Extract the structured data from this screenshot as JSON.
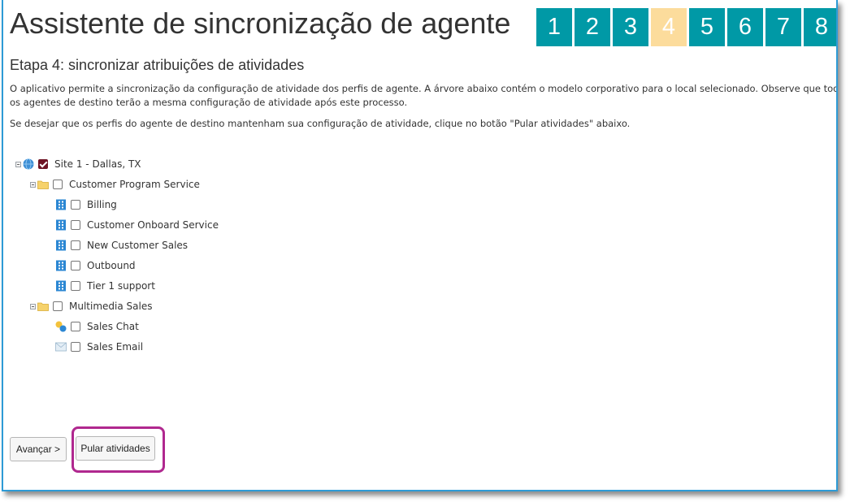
{
  "title": "Assistente de sincronização de agente",
  "steps": [
    {
      "label": "1",
      "active": false
    },
    {
      "label": "2",
      "active": false
    },
    {
      "label": "3",
      "active": false
    },
    {
      "label": "4",
      "active": true
    },
    {
      "label": "5",
      "active": false
    },
    {
      "label": "6",
      "active": false
    },
    {
      "label": "7",
      "active": false
    },
    {
      "label": "8",
      "active": false
    }
  ],
  "subtitle": "Etapa 4: sincronizar atribuições de atividades",
  "description": "O aplicativo permite a sincronização da configuração de atividade dos perfis de agente. A árvore abaixo contém o modelo corporativo para o local selecionado. Observe que todos os agentes de destino terão a mesma configuração de atividade após este processo.",
  "skip_note": "Se desejar que os perfis do agente de destino mantenham sua configuração de atividade, clique no botão \"Pular atividades\" abaixo.",
  "tree": {
    "site": {
      "label": "Site 1 - Dallas, TX",
      "icon": "globe-icon",
      "checked": true
    },
    "groups": [
      {
        "label": "Customer Program Service",
        "icon": "folder-icon",
        "checked": false,
        "children": [
          {
            "label": "Billing",
            "icon": "building-icon",
            "checked": false
          },
          {
            "label": "Customer Onboard Service",
            "icon": "building-icon",
            "checked": false
          },
          {
            "label": "New Customer Sales",
            "icon": "building-icon",
            "checked": false
          },
          {
            "label": "Outbound",
            "icon": "building-icon",
            "checked": false
          },
          {
            "label": "Tier 1 support",
            "icon": "building-icon",
            "checked": false
          }
        ]
      },
      {
        "label": "Multimedia Sales",
        "icon": "folder-icon",
        "checked": false,
        "children": [
          {
            "label": "Sales Chat",
            "icon": "chat-icon",
            "checked": false
          },
          {
            "label": "Sales Email",
            "icon": "email-icon",
            "checked": false
          }
        ]
      }
    ]
  },
  "buttons": {
    "next_label": "Avançar >",
    "skip_label": "Pular atividades"
  },
  "colors": {
    "step": "#0099a6",
    "step_active": "#fcdc9c",
    "frame_border": "#2d9bd6",
    "highlight": "#b0288f",
    "checkbox_checked": "#6e1425"
  }
}
